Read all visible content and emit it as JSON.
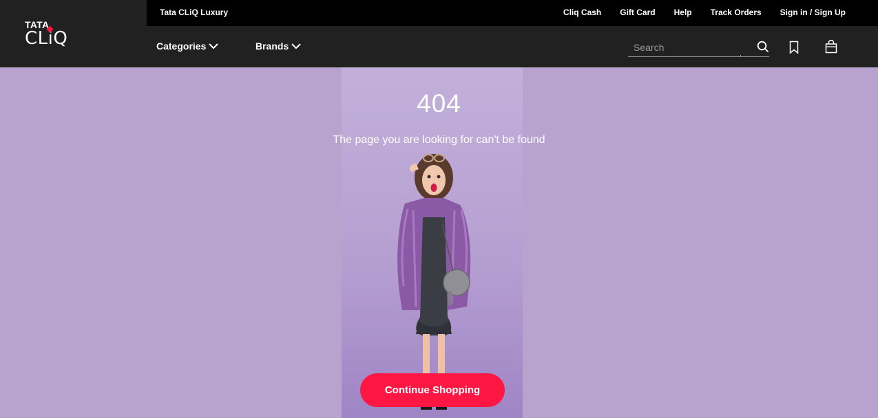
{
  "header": {
    "logo": {
      "tata": "TATA",
      "cliq": "CLiQ"
    },
    "topbar": {
      "luxury_link": "Tata CLiQ Luxury",
      "links": [
        "Cliq Cash",
        "Gift Card",
        "Help",
        "Track Orders",
        "Sign in / Sign Up"
      ]
    },
    "nav": {
      "categories": "Categories",
      "brands": "Brands"
    },
    "search": {
      "placeholder": "Search"
    },
    "icons": [
      "search-icon",
      "bookmark-icon",
      "bag-icon",
      "chevron-down-icon"
    ]
  },
  "main": {
    "error_code": "404",
    "message": "The page you are looking for can't be found",
    "cta_label": "Continue Shopping"
  },
  "colors": {
    "header_bg": "#212121",
    "topbar_bg": "#000000",
    "page_bg": "#b8a3cf",
    "accent": "#ff1744"
  }
}
